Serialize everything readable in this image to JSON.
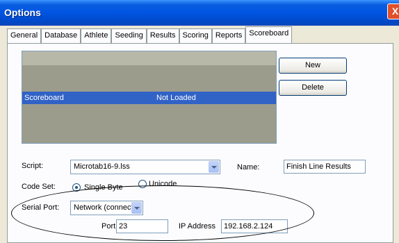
{
  "window": {
    "title": "Options",
    "close_glyph": "X"
  },
  "tabs": [
    {
      "label": "General"
    },
    {
      "label": "Database"
    },
    {
      "label": "Athlete"
    },
    {
      "label": "Seeding"
    },
    {
      "label": "Results"
    },
    {
      "label": "Scoring"
    },
    {
      "label": "Reports"
    },
    {
      "label": "Scoreboard",
      "active": true
    }
  ],
  "scoreboard_list": {
    "rows": [
      {
        "name": "Scoreboard",
        "status": "Not Loaded",
        "selected": true
      }
    ]
  },
  "buttons": {
    "new_label": "New",
    "delete_label": "Delete"
  },
  "script": {
    "label": "Script:",
    "value": "Microtab16-9.lss"
  },
  "name": {
    "label": "Name:",
    "value": "Finish Line Results"
  },
  "code_set": {
    "label": "Code Set:",
    "options": [
      {
        "label": "Single Byte",
        "selected": true
      },
      {
        "label": "Unicode",
        "selected": false
      }
    ]
  },
  "serial_port": {
    "label": "Serial Port:",
    "value": "Network (connect"
  },
  "port": {
    "label": "Port",
    "value": "23"
  },
  "ip_address": {
    "label": "IP Address",
    "value": "192.168.2.124"
  },
  "colors": {
    "title_bar": "#0054e3",
    "selection": "#3162c6",
    "list_bg": "#9c9c8c"
  }
}
